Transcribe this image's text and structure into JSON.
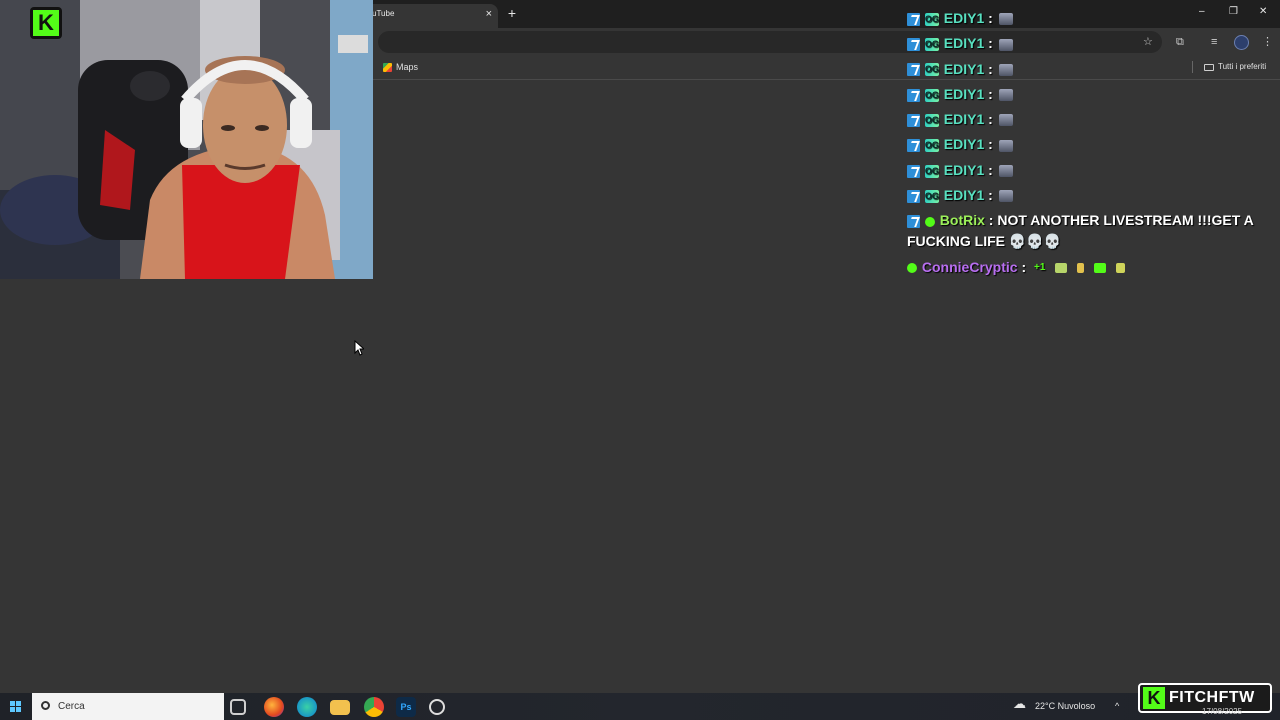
{
  "browser": {
    "tab_title": "uTube",
    "tab_close": "×",
    "new_tab": "+",
    "bookmarks": {
      "maps_label": "Maps",
      "all_label": "Tutti i preferiti"
    }
  },
  "window_controls": {
    "minimize": "–",
    "restore": "❐",
    "close": "✕"
  },
  "chat": {
    "messages": [
      {
        "user": "EDIY1",
        "sep": " :",
        "user_color": "#58e0c0"
      },
      {
        "user": "EDIY1",
        "sep": " :",
        "user_color": "#58e0c0"
      },
      {
        "user": "EDIY1",
        "sep": " :",
        "user_color": "#58e0c0"
      },
      {
        "user": "EDIY1",
        "sep": " :",
        "user_color": "#58e0c0"
      },
      {
        "user": "EDIY1",
        "sep": " :",
        "user_color": "#58e0c0"
      },
      {
        "user": "EDIY1",
        "sep": " :",
        "user_color": "#58e0c0"
      },
      {
        "user": "EDIY1",
        "sep": " :",
        "user_color": "#58e0c0"
      },
      {
        "user": "EDIY1",
        "sep": " :",
        "user_color": "#58e0c0"
      }
    ],
    "botrix": {
      "user": "BotRix",
      "sep": " :",
      "text": " NOT ANOTHER LIVESTREAM !!!GET A FUCKING LIFE 💀💀💀",
      "user_color": "#9cf05a"
    },
    "connie": {
      "user": "ConnieCryptic",
      "sep": " :",
      "plus": "+1",
      "user_color": "#b86ef0"
    },
    "badge_og": "OG"
  },
  "taskbar": {
    "search_placeholder": "Cerca",
    "weather": "22°C  Nuvoloso",
    "date": "17/08/2025"
  },
  "overlay": {
    "brand_name": "FITCHFTW",
    "brand_k": "K",
    "accent": "#53fc18"
  }
}
